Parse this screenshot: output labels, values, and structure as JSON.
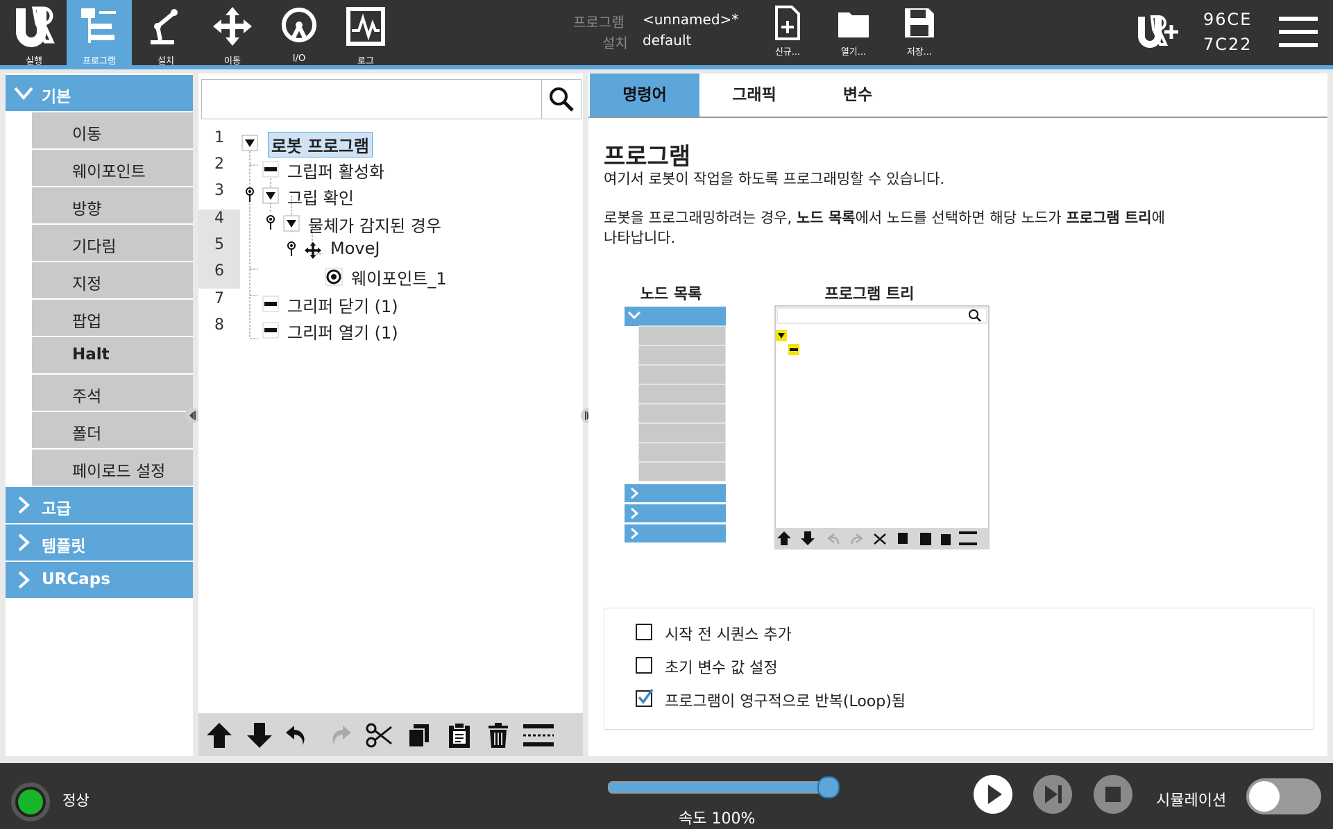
{
  "nav": {
    "items": [
      {
        "label": "실행",
        "icon": "ur-logo-icon"
      },
      {
        "label": "프로그램",
        "icon": "program-icon",
        "active": true
      },
      {
        "label": "설치",
        "icon": "robot-arm-icon"
      },
      {
        "label": "이동",
        "icon": "move-arrows-icon"
      },
      {
        "label": "I/O",
        "icon": "io-icon"
      },
      {
        "label": "로그",
        "icon": "log-icon"
      }
    ]
  },
  "program_info": {
    "program_label": "프로그램",
    "program_value": "<unnamed>*",
    "install_label": "설치",
    "install_value": "default"
  },
  "file_actions": {
    "new_label": "신규...",
    "open_label": "열기...",
    "save_label": "저장..."
  },
  "serial": {
    "line1": "96CE",
    "line2": "7C22"
  },
  "node_list": {
    "basic_label": "기본",
    "basic_items": [
      "이동",
      "웨이포인트",
      "방향",
      "기다림",
      "지정",
      "팝업",
      "Halt",
      "주석",
      "폴더",
      "페이로드 설정"
    ],
    "advanced_label": "고급",
    "template_label": "템플릿",
    "urcaps_label": "URCaps"
  },
  "tree": {
    "lines": [
      {
        "no": "1",
        "label": "로봇 프로그램"
      },
      {
        "no": "2",
        "label": "그립퍼 활성화"
      },
      {
        "no": "3",
        "label": "그립 확인"
      },
      {
        "no": "4",
        "label": "물체가 감지된 경우"
      },
      {
        "no": "5",
        "label": "MoveJ"
      },
      {
        "no": "6",
        "label": "웨이포인트_1"
      },
      {
        "no": "7",
        "label": "그리퍼 닫기 (1)"
      },
      {
        "no": "8",
        "label": "그리퍼 열기 (1)"
      }
    ]
  },
  "right": {
    "tabs": [
      "명령어",
      "그래픽",
      "변수"
    ],
    "title": "프로그램",
    "desc1": "여기서 로봇이 작업을 하도록 프로그래밍할 수 있습니다.",
    "desc2_a": "로봇을 프로그래밍하려는 경우, ",
    "desc2_b": "노드 목록",
    "desc2_c": "에서 노드를 선택하면 해당 노드가 ",
    "desc2_d": "프로그램 트리",
    "desc2_e": "에",
    "desc2_f": "나타납니다.",
    "fig_node_list": "노드 목록",
    "fig_program_tree": "프로그램 트리",
    "options": [
      {
        "label": "시작 전 시퀀스 추가",
        "checked": false
      },
      {
        "label": "초기 변수 값 설정",
        "checked": false
      },
      {
        "label": "프로그램이 영구적으로 반복(Loop)됨",
        "checked": true
      }
    ]
  },
  "bottom": {
    "status": "정상",
    "speed_label": "속도 100%",
    "speed_value": 100,
    "simulation_label": "시뮬레이션",
    "simulation_on": false
  },
  "colors": {
    "accent": "#5da6da",
    "topbar": "#333333",
    "status_ok": "#19b52a"
  }
}
